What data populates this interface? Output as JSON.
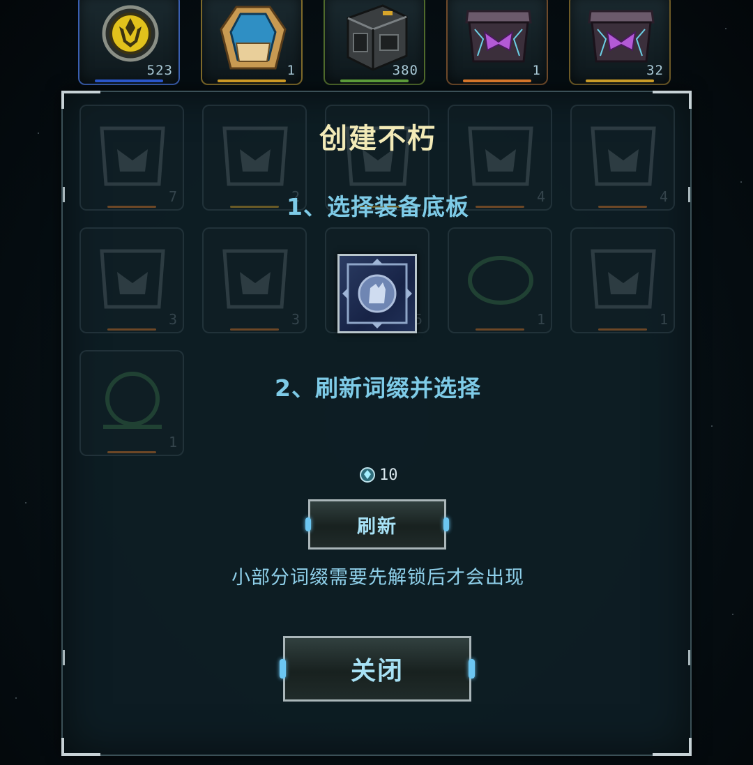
{
  "inventory": [
    {
      "count": "523",
      "bar_color": "#2d5bd6",
      "border_color": "#3a5fb0",
      "icon": "gold-emblem-icon"
    },
    {
      "count": "1",
      "bar_color": "#d8a227",
      "border_color": "#7e6a2a",
      "icon": "blue-crystal-chest-icon"
    },
    {
      "count": "380",
      "bar_color": "#61a53d",
      "border_color": "#4f6a2c",
      "icon": "metal-crate-icon"
    },
    {
      "count": "1",
      "bar_color": "#e37d2d",
      "border_color": "#6f4a2a",
      "icon": "purple-armor-box-icon"
    },
    {
      "count": "32",
      "bar_color": "#d7a52a",
      "border_color": "#6e5b27",
      "icon": "purple-armor-box-icon"
    }
  ],
  "background_grid": [
    {
      "count": "7",
      "bar_color": "#e07a2a"
    },
    {
      "count": "2",
      "bar_color": "#d7a52a"
    },
    {
      "count": "",
      "bar_color": "#d7a52a"
    },
    {
      "count": "4",
      "bar_color": "#e07a2a"
    },
    {
      "count": "4",
      "bar_color": "#e07a2a"
    },
    {
      "count": "3",
      "bar_color": "#e07a2a"
    },
    {
      "count": "3",
      "bar_color": "#e07a2a"
    },
    {
      "count": "5",
      "bar_color": "#d7a52a"
    },
    {
      "count": "1",
      "bar_color": "#e07a2a"
    },
    {
      "count": "1",
      "bar_color": "#e07a2a"
    },
    {
      "count": "1",
      "bar_color": "#e07a2a"
    }
  ],
  "dialog": {
    "title": "创建不朽",
    "step1": "1、选择装备底板",
    "base_plate_icon": "armor-base-plate-icon",
    "step2": "2、刷新词缀并选择",
    "cost_icon": "crystal-currency-icon",
    "cost_amount": "10",
    "refresh_label": "刷新",
    "hint": "小部分词缀需要先解锁后才会出现",
    "close_label": "关闭"
  },
  "colors": {
    "title": "#f2eab7",
    "step_text": "#7ecbe7",
    "button_text": "#a7e1f5",
    "button_accent": "#6cc6f2",
    "panel_bg": "#0e1e24"
  }
}
